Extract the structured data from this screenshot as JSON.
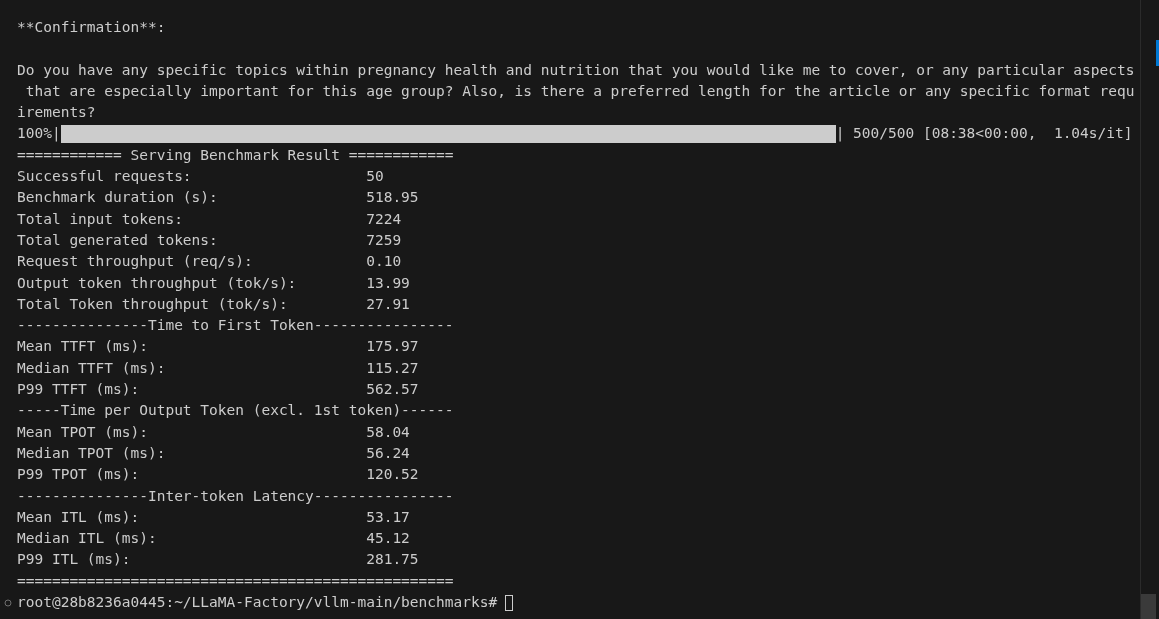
{
  "message": {
    "heading": "**Confirmation**:",
    "lines": [
      "Do you have any specific topics within pregnancy health and nutrition that you would like me to cover, or any particular aspects",
      " that are especially important for this age group? Also, is there a preferred length for the article or any specific format requ",
      "irements?"
    ]
  },
  "progress": {
    "percent": "100%|",
    "level": 1,
    "stats": "| 500/500 [08:38<00:00,  1.04s/it]"
  },
  "report": [
    {
      "kind": "rule",
      "text": "============ Serving Benchmark Result ============"
    },
    {
      "kind": "metric",
      "label": "Successful requests:",
      "value": "50"
    },
    {
      "kind": "metric",
      "label": "Benchmark duration (s):",
      "value": "518.95"
    },
    {
      "kind": "metric",
      "label": "Total input tokens:",
      "value": "7224"
    },
    {
      "kind": "metric",
      "label": "Total generated tokens:",
      "value": "7259"
    },
    {
      "kind": "metric",
      "label": "Request throughput (req/s):",
      "value": "0.10"
    },
    {
      "kind": "metric",
      "label": "Output token throughput (tok/s):",
      "value": "13.99"
    },
    {
      "kind": "metric",
      "label": "Total Token throughput (tok/s):",
      "value": "27.91"
    },
    {
      "kind": "rule",
      "text": "---------------Time to First Token----------------"
    },
    {
      "kind": "metric",
      "label": "Mean TTFT (ms):",
      "value": "175.97"
    },
    {
      "kind": "metric",
      "label": "Median TTFT (ms):",
      "value": "115.27"
    },
    {
      "kind": "metric",
      "label": "P99 TTFT (ms):",
      "value": "562.57"
    },
    {
      "kind": "rule",
      "text": "-----Time per Output Token (excl. 1st token)------"
    },
    {
      "kind": "metric",
      "label": "Mean TPOT (ms):",
      "value": "58.04"
    },
    {
      "kind": "metric",
      "label": "Median TPOT (ms):",
      "value": "56.24"
    },
    {
      "kind": "metric",
      "label": "P99 TPOT (ms):",
      "value": "120.52"
    },
    {
      "kind": "rule",
      "text": "---------------Inter-token Latency----------------"
    },
    {
      "kind": "metric",
      "label": "Mean ITL (ms):",
      "value": "53.17"
    },
    {
      "kind": "metric",
      "label": "Median ITL (ms):",
      "value": "45.12"
    },
    {
      "kind": "metric",
      "label": "P99 ITL (ms):",
      "value": "281.75"
    },
    {
      "kind": "rule",
      "text": "=================================================="
    }
  ],
  "prompt": "root@28b8236a0445:~/LLaMA-Factory/vllm-main/benchmarks#"
}
